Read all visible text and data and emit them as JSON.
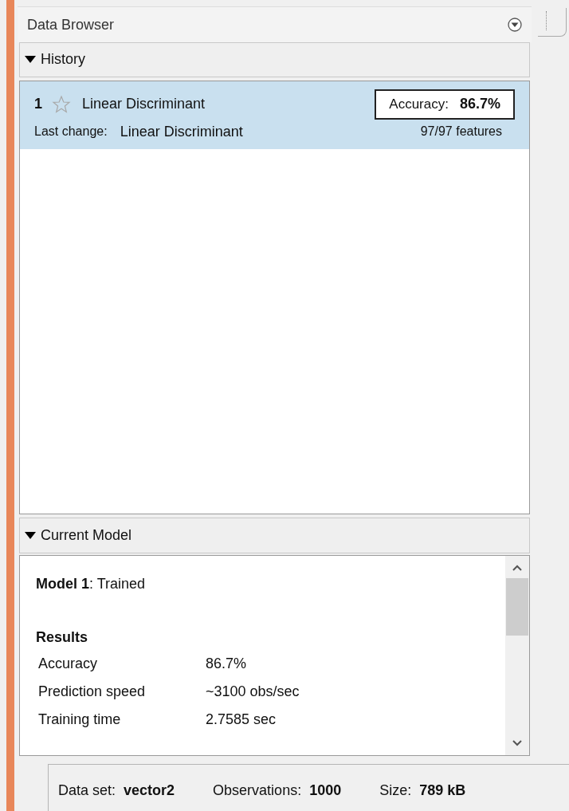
{
  "panel": {
    "title": "Data Browser"
  },
  "history": {
    "title": "History",
    "expanded": true,
    "items": [
      {
        "number": "1",
        "starred": false,
        "name": "Linear Discriminant",
        "accuracy_label": "Accuracy:",
        "accuracy": "86.7%",
        "last_change_label": "Last change:",
        "last_change": "Linear Discriminant",
        "features": "97/97 features",
        "selected": true
      }
    ]
  },
  "current_model": {
    "title": "Current Model",
    "expanded": true,
    "model": "Model 1",
    "status": ": Trained",
    "results_title": "Results",
    "results": [
      {
        "label": "Accuracy",
        "value": "86.7%"
      },
      {
        "label": "Prediction speed",
        "value": "~3100 obs/sec"
      },
      {
        "label": "Training time",
        "value": "2.7585 sec"
      }
    ]
  },
  "status_bar": [
    {
      "label": "Data set:",
      "value": "vector2"
    },
    {
      "label": "Observations:",
      "value": "1000"
    },
    {
      "label": "Size:",
      "value": "789 kB"
    }
  ]
}
